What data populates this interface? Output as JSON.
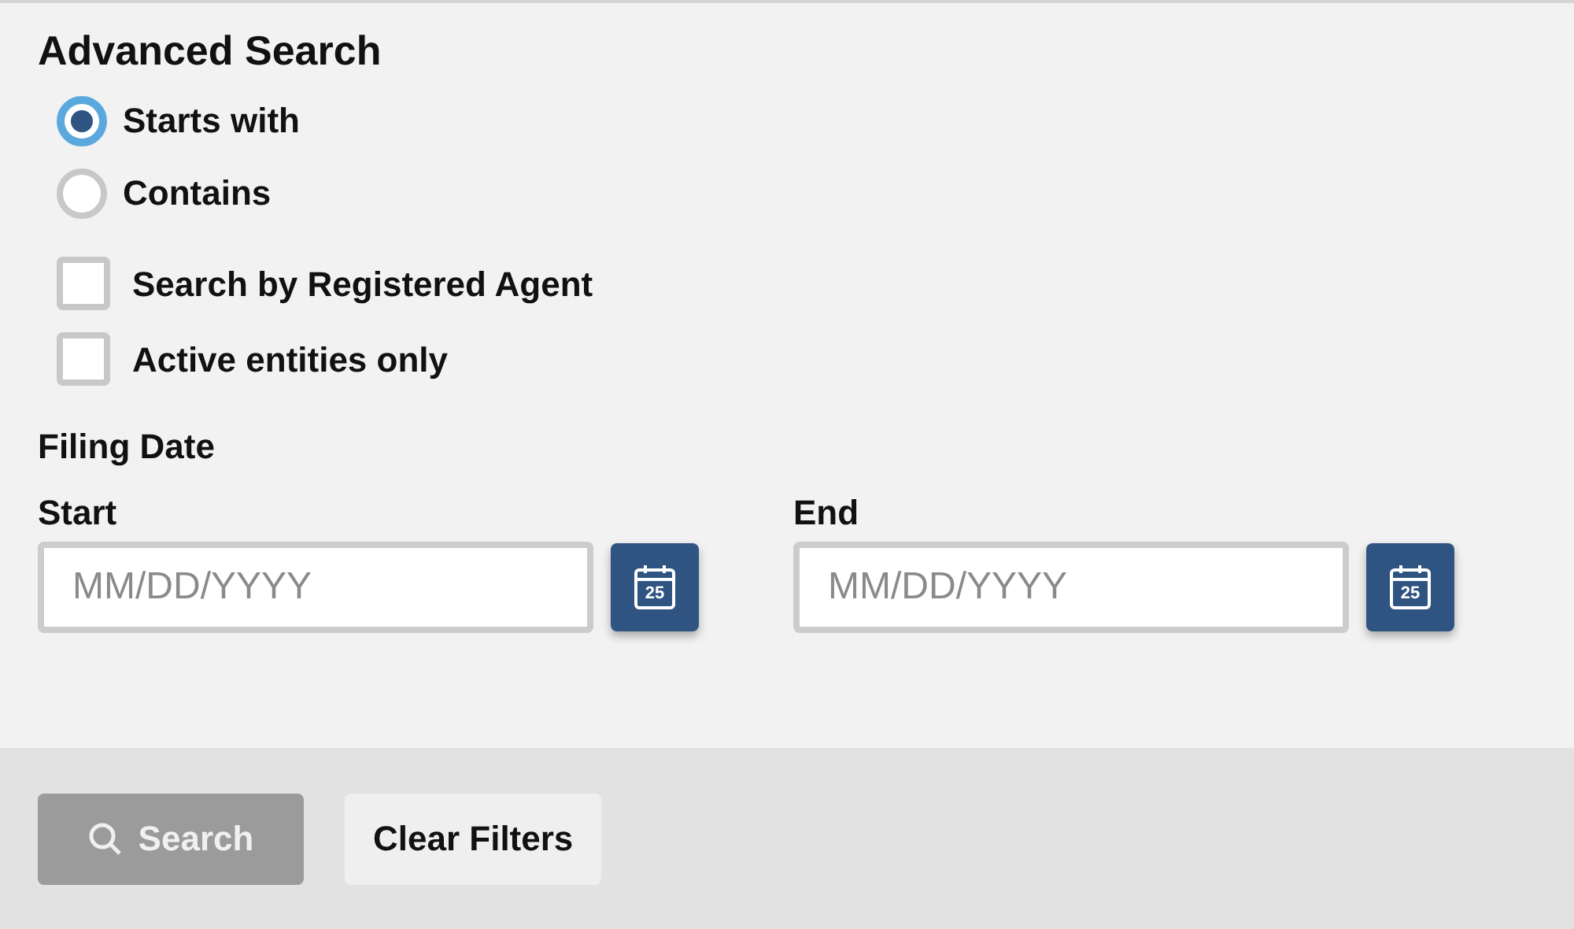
{
  "title": "Advanced Search",
  "match_options": [
    {
      "label": "Starts with",
      "selected": true
    },
    {
      "label": "Contains",
      "selected": false
    }
  ],
  "filters": [
    {
      "label": "Search by Registered Agent",
      "checked": false
    },
    {
      "label": "Active entities only",
      "checked": false
    }
  ],
  "filing_date": {
    "label": "Filing Date",
    "fields": [
      {
        "label": "Start",
        "placeholder": "MM/DD/YYYY",
        "calendar_day": "25"
      },
      {
        "label": "End",
        "placeholder": "MM/DD/YYYY",
        "calendar_day": "25"
      }
    ]
  },
  "buttons": [
    {
      "kind": "search",
      "label": "Search",
      "disabled": true
    },
    {
      "kind": "clear",
      "label": "Clear Filters",
      "disabled": false
    }
  ]
}
